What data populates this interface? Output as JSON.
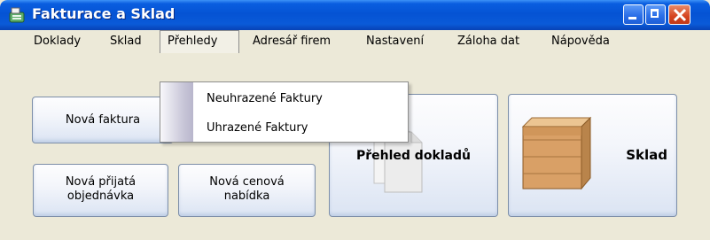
{
  "window": {
    "title": "Fakturace a Sklad"
  },
  "menu": [
    {
      "label": "Doklady"
    },
    {
      "label": "Sklad"
    },
    {
      "label": "Přehledy"
    },
    {
      "label": "Adresář firem"
    },
    {
      "label": "Nastavení"
    },
    {
      "label": "Záloha dat"
    },
    {
      "label": "Nápověda"
    }
  ],
  "dropdown": {
    "items": [
      {
        "label": "Neuhrazené Faktury"
      },
      {
        "label": "Uhrazené Faktury"
      }
    ]
  },
  "buttons": {
    "nova_faktura": "Nová faktura",
    "nova_objednavka": "Nová přijatá\nobjednávka",
    "nova_nabidka": "Nová cenová\nnabídka",
    "prehled_dokladu": "Přehled dokladů",
    "sklad": "Sklad"
  },
  "colors": {
    "titlebar": "#0553d4",
    "close_button": "#d5431f",
    "window_bg": "#ECE9D8"
  },
  "icons": {
    "app": "cash-register-icon",
    "prehled": "documents-icon",
    "sklad": "wooden-crate-icon"
  }
}
